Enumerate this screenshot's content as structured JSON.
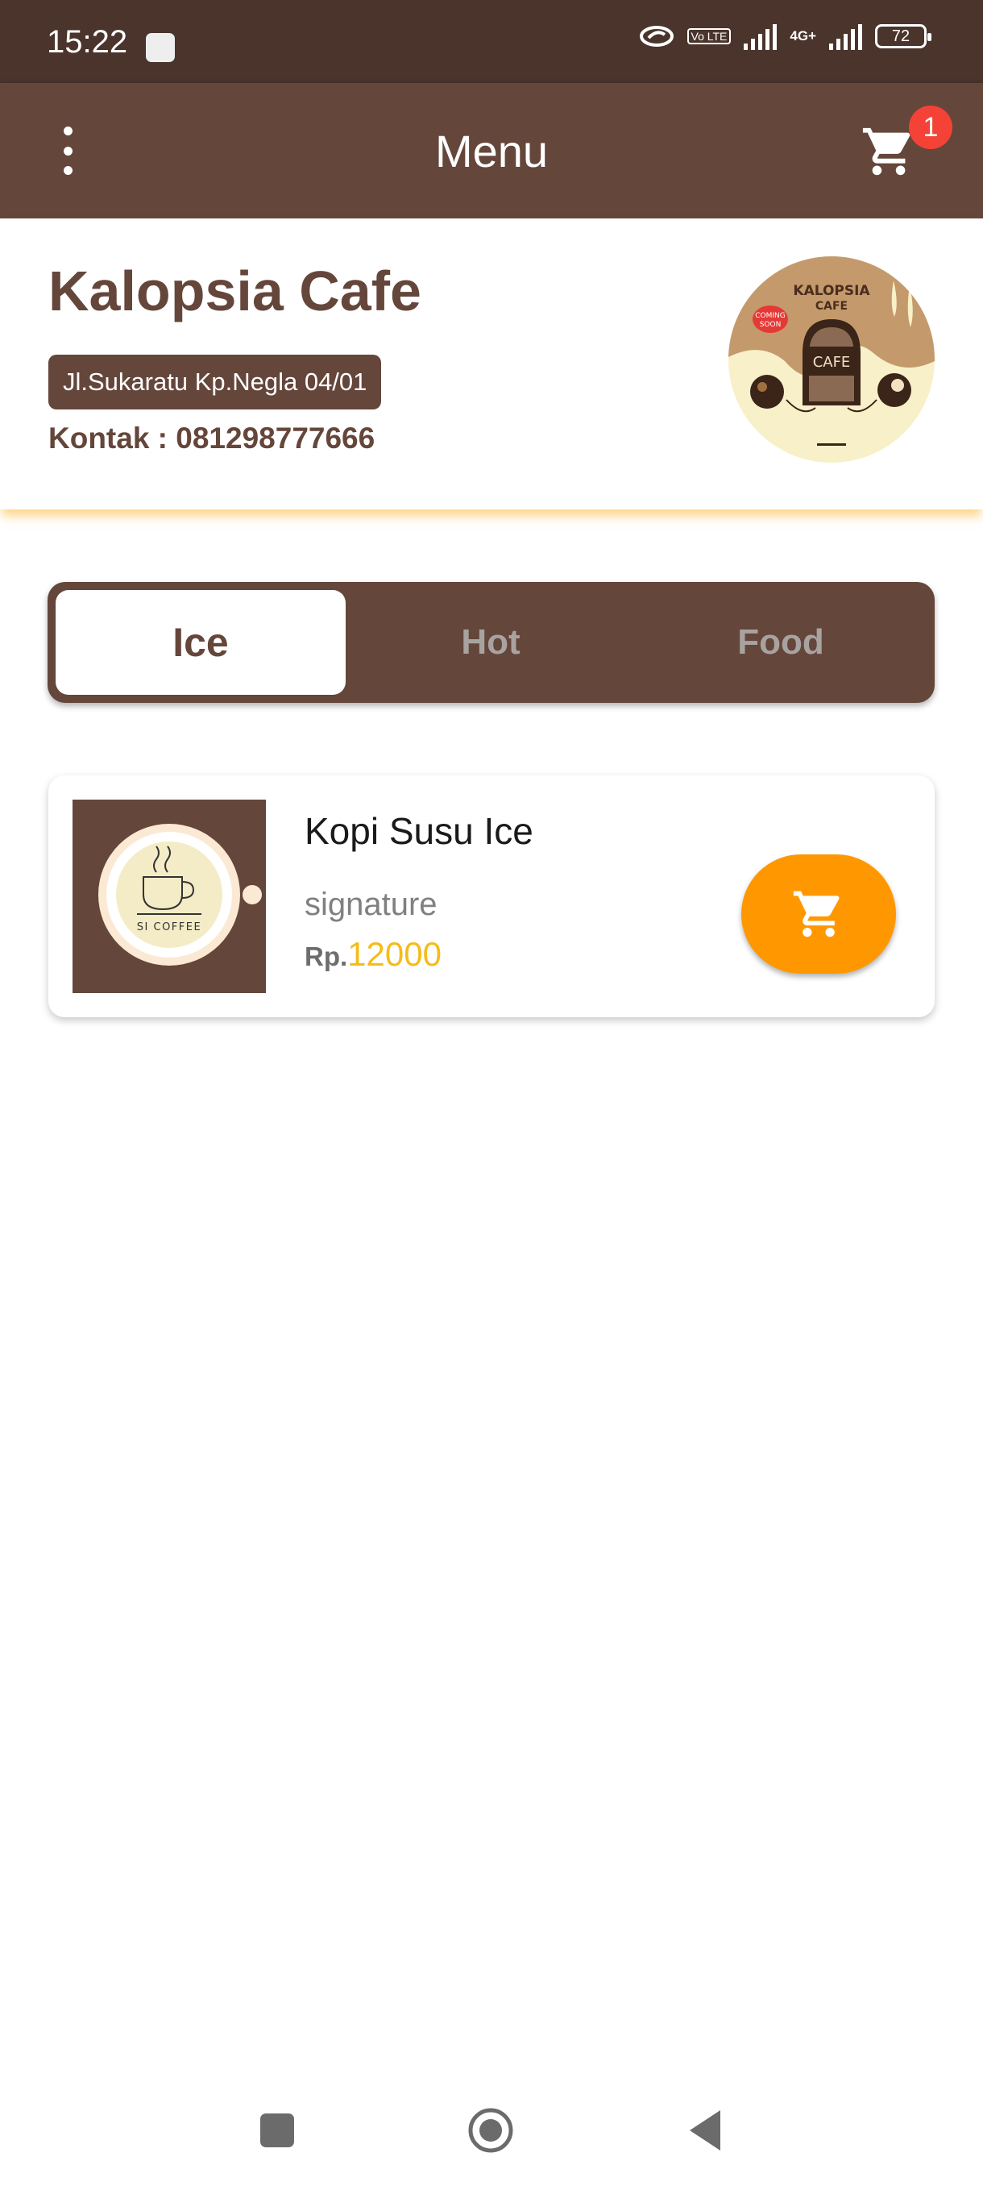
{
  "status_bar": {
    "time": "15:22",
    "network": "4G+",
    "volte": "Vo LTE",
    "battery": "72"
  },
  "app_bar": {
    "title": "Menu",
    "cart_count": "1"
  },
  "cafe": {
    "name": "Kalopsia Cafe",
    "address": "Jl.Sukaratu Kp.Negla 04/01",
    "contact": "Kontak : 081298777666",
    "logo_text": {
      "line1": "KALOPSIA",
      "line2": "CAFE",
      "badge1": "COMING",
      "badge2": "SOON",
      "door": "CAFE"
    }
  },
  "tabs": [
    {
      "label": "Ice",
      "active": true
    },
    {
      "label": "Hot",
      "active": false
    },
    {
      "label": "Food",
      "active": false
    }
  ],
  "products": [
    {
      "name": "Kopi Susu Ice",
      "description": "signature",
      "price_prefix": "Rp.",
      "price": "12000",
      "thumb_text": "SI COFFEE"
    }
  ],
  "colors": {
    "brown": "#65463b",
    "status_bar": "#4a342c",
    "accent_orange": "#ff9800",
    "price_yellow": "#f4bc19",
    "badge_red": "#f44336"
  }
}
